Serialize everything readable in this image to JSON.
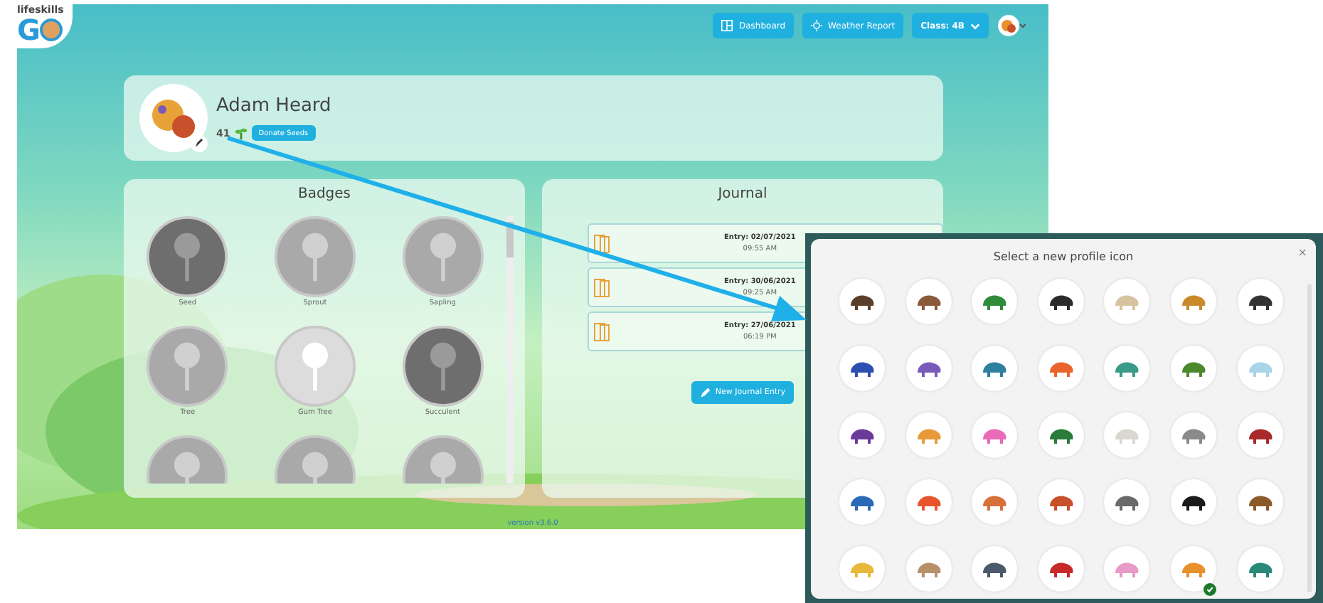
{
  "logo": {
    "text": "lifeskills",
    "letter": "G"
  },
  "nav": [
    {
      "label": "Dashboard",
      "kind": "dashboard"
    },
    {
      "label": "Weather Report",
      "kind": "weather"
    }
  ],
  "class_select": {
    "label": "Class: 4B"
  },
  "profile": {
    "name": "Adam Heard",
    "seeds": "41",
    "donate_button": "Donate Seeds"
  },
  "badges": {
    "title": "Badges",
    "items": [
      {
        "label": "Seed",
        "kind": "dark"
      },
      {
        "label": "Sprout",
        "kind": "mid"
      },
      {
        "label": "Sapling",
        "kind": "mid"
      },
      {
        "label": "Tree",
        "kind": "mid"
      },
      {
        "label": "Gum Tree",
        "kind": "light"
      },
      {
        "label": "Succulent",
        "kind": "dark"
      },
      {
        "kind": "mid"
      },
      {
        "kind": "mid"
      },
      {
        "kind": "mid"
      }
    ]
  },
  "journal": {
    "title": "Journal",
    "entries": [
      {
        "title": "Entry: 02/07/2021",
        "time": "09:55 AM"
      },
      {
        "title": "Entry: 30/06/2021",
        "time": "09:25 AM"
      },
      {
        "title": "Entry: 27/06/2021",
        "time": "06:19 PM"
      }
    ],
    "new_button": "New Journal Entry"
  },
  "version": "version v3.6.0",
  "popup": {
    "title": "Select a new profile icon",
    "close": "×",
    "icons": [
      {
        "color": "#5a3f2a",
        "selected": false
      },
      {
        "color": "#8a5a3a",
        "selected": false
      },
      {
        "color": "#2e8b3a",
        "selected": false
      },
      {
        "color": "#2b2b2b",
        "selected": false
      },
      {
        "color": "#d8c3a0",
        "selected": false
      },
      {
        "color": "#c98a2a",
        "selected": false
      },
      {
        "color": "#333333",
        "selected": false
      },
      {
        "color": "#2a4fb0",
        "selected": false
      },
      {
        "color": "#7a5ab8",
        "selected": false
      },
      {
        "color": "#2f7f9f",
        "selected": false
      },
      {
        "color": "#e8642a",
        "selected": false
      },
      {
        "color": "#3a9a8a",
        "selected": false
      },
      {
        "color": "#4a8a2a",
        "selected": false
      },
      {
        "color": "#a8d4e8",
        "selected": false
      },
      {
        "color": "#6a3a9a",
        "selected": false
      },
      {
        "color": "#e89a3a",
        "selected": false
      },
      {
        "color": "#e86ab8",
        "selected": false
      },
      {
        "color": "#2a7a3a",
        "selected": false
      },
      {
        "color": "#d8d8d0",
        "selected": false
      },
      {
        "color": "#8a8a8a",
        "selected": false
      },
      {
        "color": "#a82a2a",
        "selected": false
      },
      {
        "color": "#2a6ab8",
        "selected": false
      },
      {
        "color": "#e8542a",
        "selected": false
      },
      {
        "color": "#d8703a",
        "selected": false
      },
      {
        "color": "#c8502a",
        "selected": false
      },
      {
        "color": "#6a6a6a",
        "selected": false
      },
      {
        "color": "#1a1a1a",
        "selected": false
      },
      {
        "color": "#8a5a2a",
        "selected": false
      },
      {
        "color": "#e8b83a",
        "selected": false
      },
      {
        "color": "#b8906a",
        "selected": false
      },
      {
        "color": "#4a5a6a",
        "selected": false
      },
      {
        "color": "#c82a2a",
        "selected": false
      },
      {
        "color": "#e89ac8",
        "selected": false
      },
      {
        "color": "#e8902a",
        "selected": true
      },
      {
        "color": "#2a8a7a",
        "selected": false
      }
    ]
  }
}
